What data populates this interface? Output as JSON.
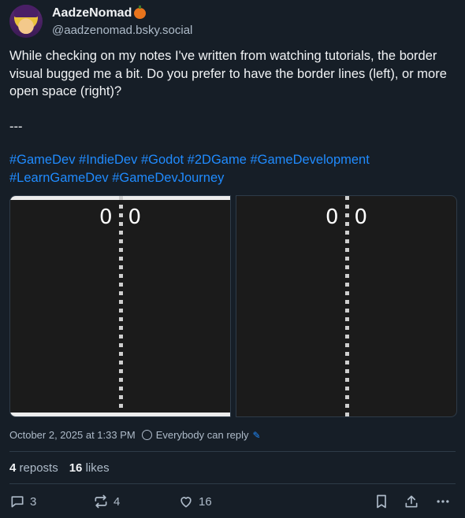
{
  "author": {
    "display_name": "AadzeNomad",
    "handle": "@aadzenomad.bsky.social"
  },
  "post": {
    "text": "While checking on my notes I've written from watching tutorials, the border visual bugged me a bit. Do you prefer to have the border lines (left), or more open space (right)?\n\n---",
    "hashtags": [
      "#GameDev",
      "#IndieDev",
      "#Godot",
      "#2DGame",
      "#GameDevelopment",
      "#LearnGameDev",
      "#GameDevJourney"
    ]
  },
  "media": {
    "left": {
      "score_p1": "0",
      "score_p2": "0"
    },
    "right": {
      "score_p1": "0",
      "score_p2": "0"
    }
  },
  "meta": {
    "timestamp": "October 2, 2025 at 1:33 PM",
    "reply_setting": "Everybody can reply"
  },
  "stats": {
    "reposts_count": "4",
    "reposts_label": "reposts",
    "likes_count": "16",
    "likes_label": "likes"
  },
  "actions": {
    "reply_count": "3",
    "repost_count": "4",
    "like_count": "16"
  },
  "colors": {
    "background": "#161e27",
    "link": "#208bfe",
    "muted": "#aebbc9"
  }
}
